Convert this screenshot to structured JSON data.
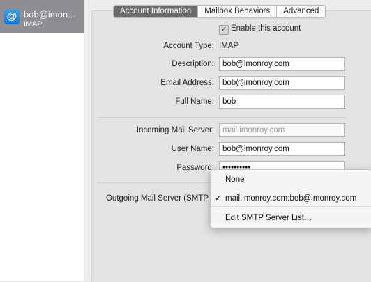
{
  "sidebar": {
    "account": {
      "name": "bob@imon...",
      "type": "IMAP",
      "icon": "at-sign-icon"
    }
  },
  "tabs": [
    {
      "label": "Account Information",
      "active": true
    },
    {
      "label": "Mailbox Behaviors",
      "active": false
    },
    {
      "label": "Advanced",
      "active": false
    }
  ],
  "form": {
    "enable_label": "Enable this account",
    "enable_checked": true,
    "account_type_label": "Account Type:",
    "account_type_value": "IMAP",
    "description_label": "Description:",
    "description_value": "bob@imonroy.com",
    "email_label": "Email Address:",
    "email_value": "bob@imonroy.com",
    "fullname_label": "Full Name:",
    "fullname_value": "bob",
    "incoming_label": "Incoming Mail Server:",
    "incoming_value": "mail.imonroy.com",
    "username_label": "User Name:",
    "username_value": "bob@imonroy.com",
    "password_label": "Password:",
    "password_value": "••••••••••",
    "outgoing_label": "Outgoing Mail Server (SMTP"
  },
  "smtp_menu": {
    "items": [
      {
        "label": "None",
        "checked": false
      },
      {
        "label": "mail.imonroy.com:bob@imonroy.com",
        "checked": true
      },
      {
        "label": "Edit SMTP Server List…",
        "checked": false
      }
    ],
    "check_glyph": "✓"
  }
}
